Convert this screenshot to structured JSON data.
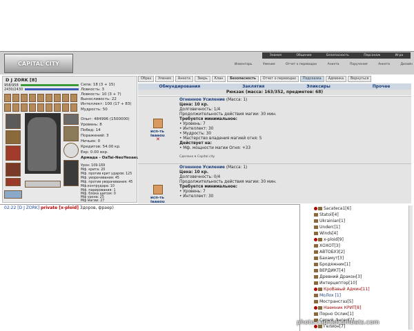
{
  "header": {
    "logo_text": "CAPITAL CITY",
    "menu1": [
      "Знания",
      "Общение",
      "Безопасность",
      "Персонаж",
      "Игра"
    ],
    "menu2": [
      "Инвентарь",
      "Умения",
      "Отчет о переводах",
      "Анкета",
      "Поручения",
      "Анкета",
      "Дизайн"
    ]
  },
  "character": {
    "name": "D J ZORK",
    "level": "[8]",
    "hp": "958/958",
    "mana": "2430/2430",
    "stats": [
      "Сила: 18 (3 + 15)",
      "Ловкость: 3",
      "Ловкость: 10 (3 + 7)",
      "Выносливость: 22",
      "Интеллект: 100 (17 + 83)",
      "Мудрость: 50"
    ],
    "info": [
      "Опыт: 484996 (1500000)",
      "Уровень: 8",
      "Побед: 14",
      "Поражений: 3",
      "Ничьих: 0",
      "Кредитов: 54.00 кр.",
      "Екр: 0.00 екр.",
      "Армада - OaTai-NeoYeoaeu"
    ],
    "details": [
      "Урон: 109-169",
      "Мф. крита: 20",
      "Мф. против крит ударов: 125",
      "Мф. уворачивания: 45",
      "Мф. против уворачивания: 45",
      "Мф.контрудара: 10",
      "Мф. парирования: 1",
      "Мф. блока щитом: 0",
      "Мф урона: 25",
      "Мф магии: 27"
    ]
  },
  "tabs": [
    "Образ",
    "Умения",
    "Анкета",
    "Зверь",
    "Клан",
    "Безопасность",
    "Отчет о переводах",
    "Подсказка",
    "Админка",
    "Вернуться"
  ],
  "sections": [
    "Обмундирования",
    "Заклятия",
    "Эликсиры",
    "Прочее"
  ],
  "backpack": "Рюкзак (масса: 163/352, предметов: 68)",
  "items": [
    {
      "use_label": "исп-ть",
      "use_label2": "iaaaou",
      "title": "Огненное Усиление",
      "mass": " (Масса: 1)",
      "lines": [
        "Цена: 10 кр.",
        "Долговечность: 1/4",
        "Продолжительность действия магии: 30 мин.",
        "Требуется минимальное:",
        "• Уровень: 7",
        "• Интеллект: 30",
        "• Мудрость: 30",
        "• Мастерство владения магией огня: 5",
        "Действует на:",
        "• Мф. мощности магии Огня: +33"
      ],
      "footer": "Сделано в Capital city"
    },
    {
      "use_label": "исп-ть",
      "use_label2": "iaaaou",
      "title": "Огненное Усиление",
      "mass": " (Масса: 1)",
      "lines": [
        "Цена: 10 кр.",
        "Долговечность: 0/4",
        "Продолжительность действия магии: 30 мин.",
        "Требуется минимальное:",
        "• Уровень: 7",
        "• Интеллект: 30"
      ]
    }
  ],
  "chat": {
    "time": "02:22",
    "nick": "[D J ZORK]",
    "private": "private [x-ploid]",
    "text": " Здоров, фраер)"
  },
  "online": [
    "Sacateca1[6]",
    "Statoil[4]",
    "Ukrainian[1]",
    "Underc[1]",
    "Winds[4]",
    "x-ploid[9]",
    "ХОХОТ[3]",
    "АВТОБУЗ[2]",
    "Бахамут[3]",
    "Бродяжник[1]",
    "ВЕРДИКТ[4]",
    "Древний Дракон[3]",
    "Интерцептор[10]",
    "КроВавый Админ[11]",
    "МоЛох [1]",
    "Мострансгаз[5]",
    "Наемник КРИТ[8]",
    "Порно Ослик[1]",
    "Серый_Ангел[1]",
    "Гелион[7]"
  ],
  "watermark": "photo.capitalcombats.com"
}
